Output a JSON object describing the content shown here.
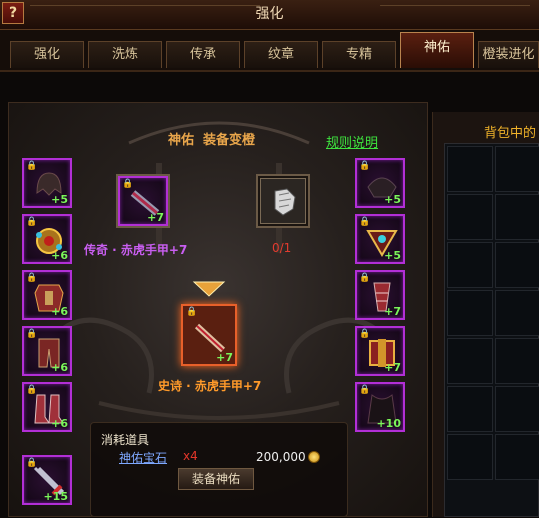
{
  "window": {
    "title": "强化",
    "help_label": "?"
  },
  "tabs": [
    {
      "label": "强化",
      "active": false
    },
    {
      "label": "洗炼",
      "active": false
    },
    {
      "label": "传承",
      "active": false
    },
    {
      "label": "纹章",
      "active": false
    },
    {
      "label": "专精",
      "active": false
    },
    {
      "label": "神佑",
      "active": true
    },
    {
      "label": "橙装进化",
      "active": false
    }
  ],
  "panel": {
    "heading": "神佑  装备变橙",
    "rules_link": "规则说明",
    "source": {
      "name": "传奇 · 赤虎手甲+7",
      "level": "+7",
      "icon": "gauntlet-icon"
    },
    "material": {
      "count": "0/1",
      "icon": "silver-gauntlet-icon"
    },
    "arrow_icon": "down-arrow-icon",
    "target": {
      "name": "史诗 · 赤虎手甲+7",
      "level": "+7",
      "icon": "gauntlet-icon"
    }
  },
  "left_slots": [
    {
      "icon": "helmet-icon",
      "level": "+5"
    },
    {
      "icon": "necklace-icon",
      "level": "+6"
    },
    {
      "icon": "armor-icon",
      "level": "+6"
    },
    {
      "icon": "leggings-icon",
      "level": "+6"
    },
    {
      "icon": "boots-icon",
      "level": "+6"
    }
  ],
  "right_slots": [
    {
      "icon": "shoulder-icon",
      "level": "+5"
    },
    {
      "icon": "amulet-icon",
      "level": "+5"
    },
    {
      "icon": "bracer-icon",
      "level": "+7"
    },
    {
      "icon": "belt-icon",
      "level": "+7"
    },
    {
      "icon": "cloak-icon",
      "level": "+10"
    }
  ],
  "weapon_slot": {
    "icon": "sword-icon",
    "level": "+15"
  },
  "consume": {
    "title": "消耗道具",
    "gem_name": "神佑宝石",
    "gem_qty": "x4",
    "cost": "200,000",
    "currency_icon": "gold-coin-icon",
    "action_label": "装备神佑"
  },
  "bag": {
    "title": "背包中的"
  },
  "colors": {
    "purple_border": "#b22fd6",
    "orange_name": "#ff9a2a",
    "purple_name": "#c85ef0",
    "green_link": "#3ee43e",
    "accent_gold": "#f0b32a"
  }
}
